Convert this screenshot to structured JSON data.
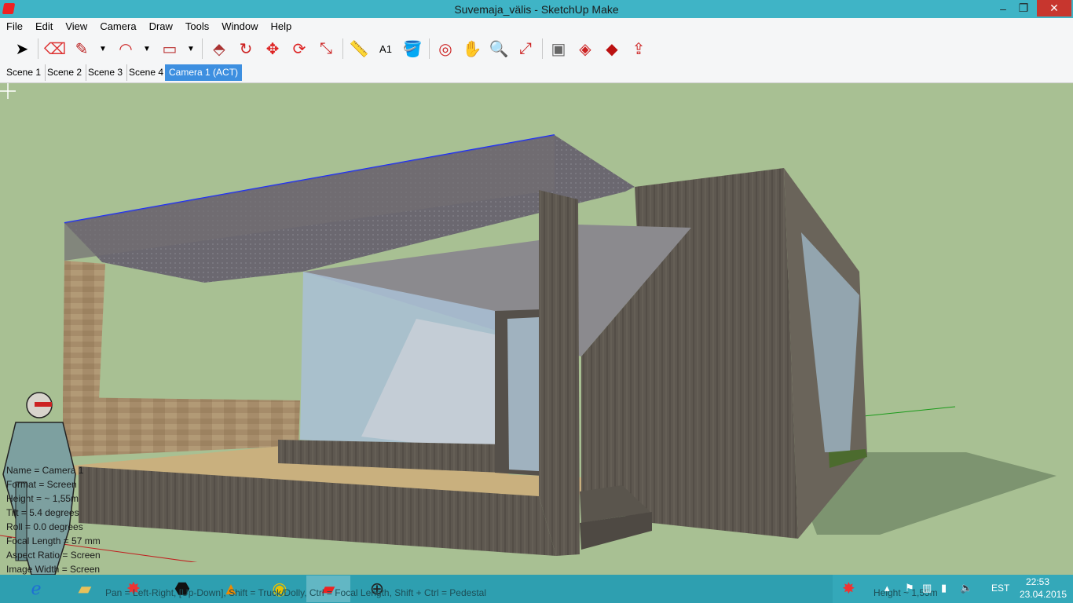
{
  "window": {
    "title": "Suvemaja_välis - SketchUp Make",
    "minimize": "–",
    "maximize": "❐",
    "close": "✕"
  },
  "menu": [
    "File",
    "Edit",
    "View",
    "Camera",
    "Draw",
    "Tools",
    "Window",
    "Help"
  ],
  "toolbar": {
    "select": "➤",
    "eraser": "⌫",
    "pencil": "✎",
    "arc": "◠",
    "rectangle": "▭",
    "pushpull": "⬘",
    "followme": "↻",
    "move": "✥",
    "rotate": "⟳",
    "scale": "⤡",
    "tape": "📏",
    "text": "A1",
    "paint": "🪣",
    "orbit": "◎",
    "pan": "✋",
    "zoom": "🔍",
    "zoom_extents": "⤢",
    "previous": "▣",
    "warehouse1": "◈",
    "warehouse2": "◆",
    "share": "⇪",
    "dropdown": "▼"
  },
  "scenes": [
    {
      "label": "Scene 1",
      "active": false
    },
    {
      "label": "Scene 2",
      "active": false
    },
    {
      "label": "Scene 3",
      "active": false
    },
    {
      "label": "Scene 4",
      "active": false
    },
    {
      "label": "Camera 1 (ACT)",
      "active": true
    }
  ],
  "camera_info": [
    "Name = Camera 1",
    "Format = Screen",
    "Height = ~ 1,55m",
    "Tilt = 5.4 degrees",
    "Roll = 0.0 degrees",
    "Focal Length = 57 mm",
    "Aspect Ratio = Screen",
    "Image Width = Screen"
  ],
  "status": {
    "hint": "Pan = Left-Right, [Up-Down], Shift = Truck/Dolly, Ctrl = Focal Length, Shift + Ctrl = Pedestal",
    "measure_label": "Height",
    "measure_value": "~ 1,55m"
  },
  "taskbar": {
    "apps": [
      "ie",
      "explorer",
      "app-red",
      "app-dark",
      "vlc",
      "chrome",
      "sketchup",
      "app-globe"
    ],
    "lang": "EST",
    "time": "22:53",
    "date": "23.04.2015"
  },
  "colors": {
    "titlebar": "#3fb4c6",
    "sky": "#a8c093",
    "ground": "#a8c093",
    "active_tab": "#3d8fe0",
    "taskbar": "#2e9fb0"
  }
}
